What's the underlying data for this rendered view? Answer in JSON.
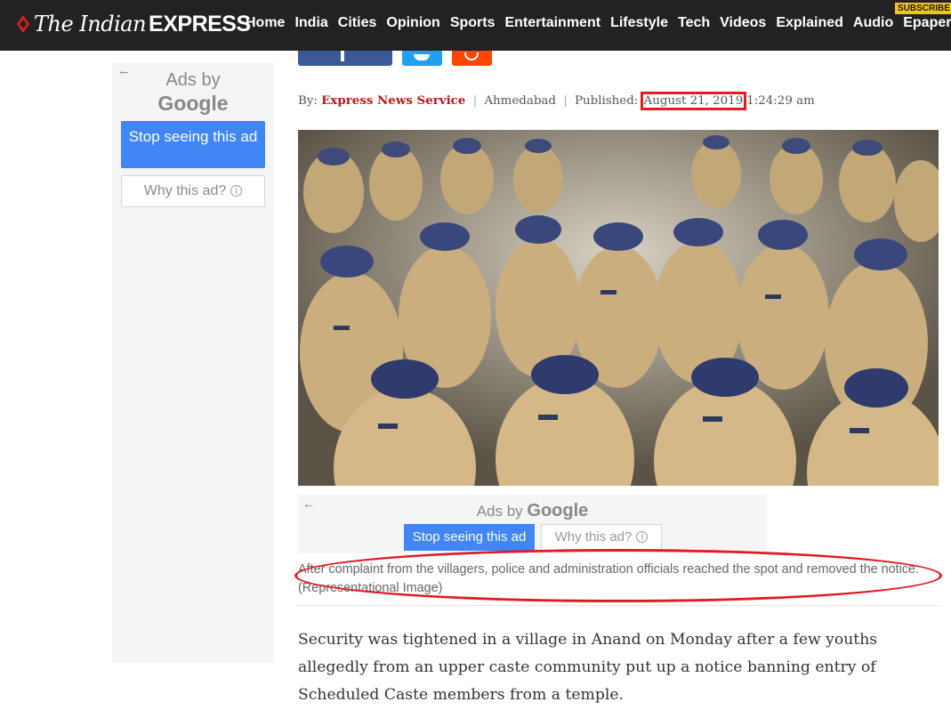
{
  "navbar": {
    "logo_the": "The Indian",
    "logo_express": "EXPRESS",
    "items": [
      "Home",
      "India",
      "Cities",
      "Opinion",
      "Sports",
      "Entertainment",
      "Lifestyle",
      "Tech",
      "Videos",
      "Explained",
      "Audio",
      "Epaper"
    ],
    "subscribe_label": "SUBSCRIBE",
    "background_color": "#222222",
    "subscribe_color": "#f6c21a"
  },
  "side_ad": {
    "back_icon": "back-arrow-icon",
    "ads_by": "Ads by",
    "google": "Google",
    "stop_label": "Stop seeing this ad",
    "why_label": "Why this ad?",
    "info_icon": "info-icon"
  },
  "share": {
    "facebook_icon": "facebook-icon",
    "twitter_icon": "twitter-icon",
    "reddit_icon": "reddit-icon"
  },
  "byline": {
    "by": "By:",
    "author": "Express News Service",
    "location": "Ahmedabad",
    "published_label": "Published:",
    "date": "August 21, 2019",
    "time": "1:24:29 am",
    "highlight_color": "#e01b24"
  },
  "hero": {
    "icon": "police-crowd-photo"
  },
  "inline_ad": {
    "back_icon": "back-arrow-icon",
    "ads_by": "Ads by",
    "google": "Google",
    "stop_label": "Stop seeing this ad",
    "why_label": "Why this ad?",
    "button_color": "#4285f4"
  },
  "caption": {
    "text": "After complaint from the villagers, police and administration officials reached the spot and removed the notice. (Representational Image)"
  },
  "article": {
    "paragraph": "Security was tightened in a village in Anand on Monday after a few youths allegedly from an upper caste community put up a notice banning entry of Scheduled Caste members from a temple."
  }
}
